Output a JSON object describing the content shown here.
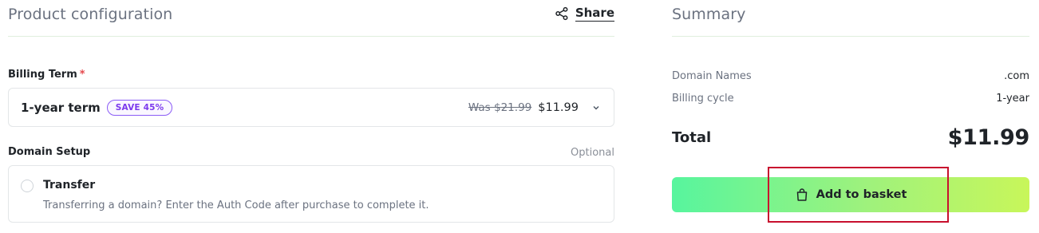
{
  "config": {
    "title": "Product configuration",
    "share_label": "Share",
    "billing": {
      "label": "Billing Term",
      "required_marker": "*",
      "term": "1-year term",
      "badge": "SAVE 45%",
      "was_price": "Was $21.99",
      "price": "$11.99"
    },
    "domain_setup": {
      "label": "Domain Setup",
      "optional_label": "Optional",
      "option_title": "Transfer",
      "option_desc": "Transferring a domain? Enter the Auth Code after purchase to complete it."
    }
  },
  "summary": {
    "title": "Summary",
    "rows": [
      {
        "key": "Domain Names",
        "value": ".com"
      },
      {
        "key": "Billing cycle",
        "value": "1-year"
      }
    ],
    "total_label": "Total",
    "total_value": "$11.99",
    "add_button_label": "Add to basket"
  },
  "colors": {
    "badge": "#7c3aed",
    "required": "#e5484d",
    "button_gradient_start": "#57f59e",
    "button_gradient_end": "#c8f65a",
    "highlight": "#c8102e"
  },
  "icons": {
    "share": "share-icon",
    "chevron": "chevron-down-icon",
    "bag": "shopping-bag-icon"
  }
}
